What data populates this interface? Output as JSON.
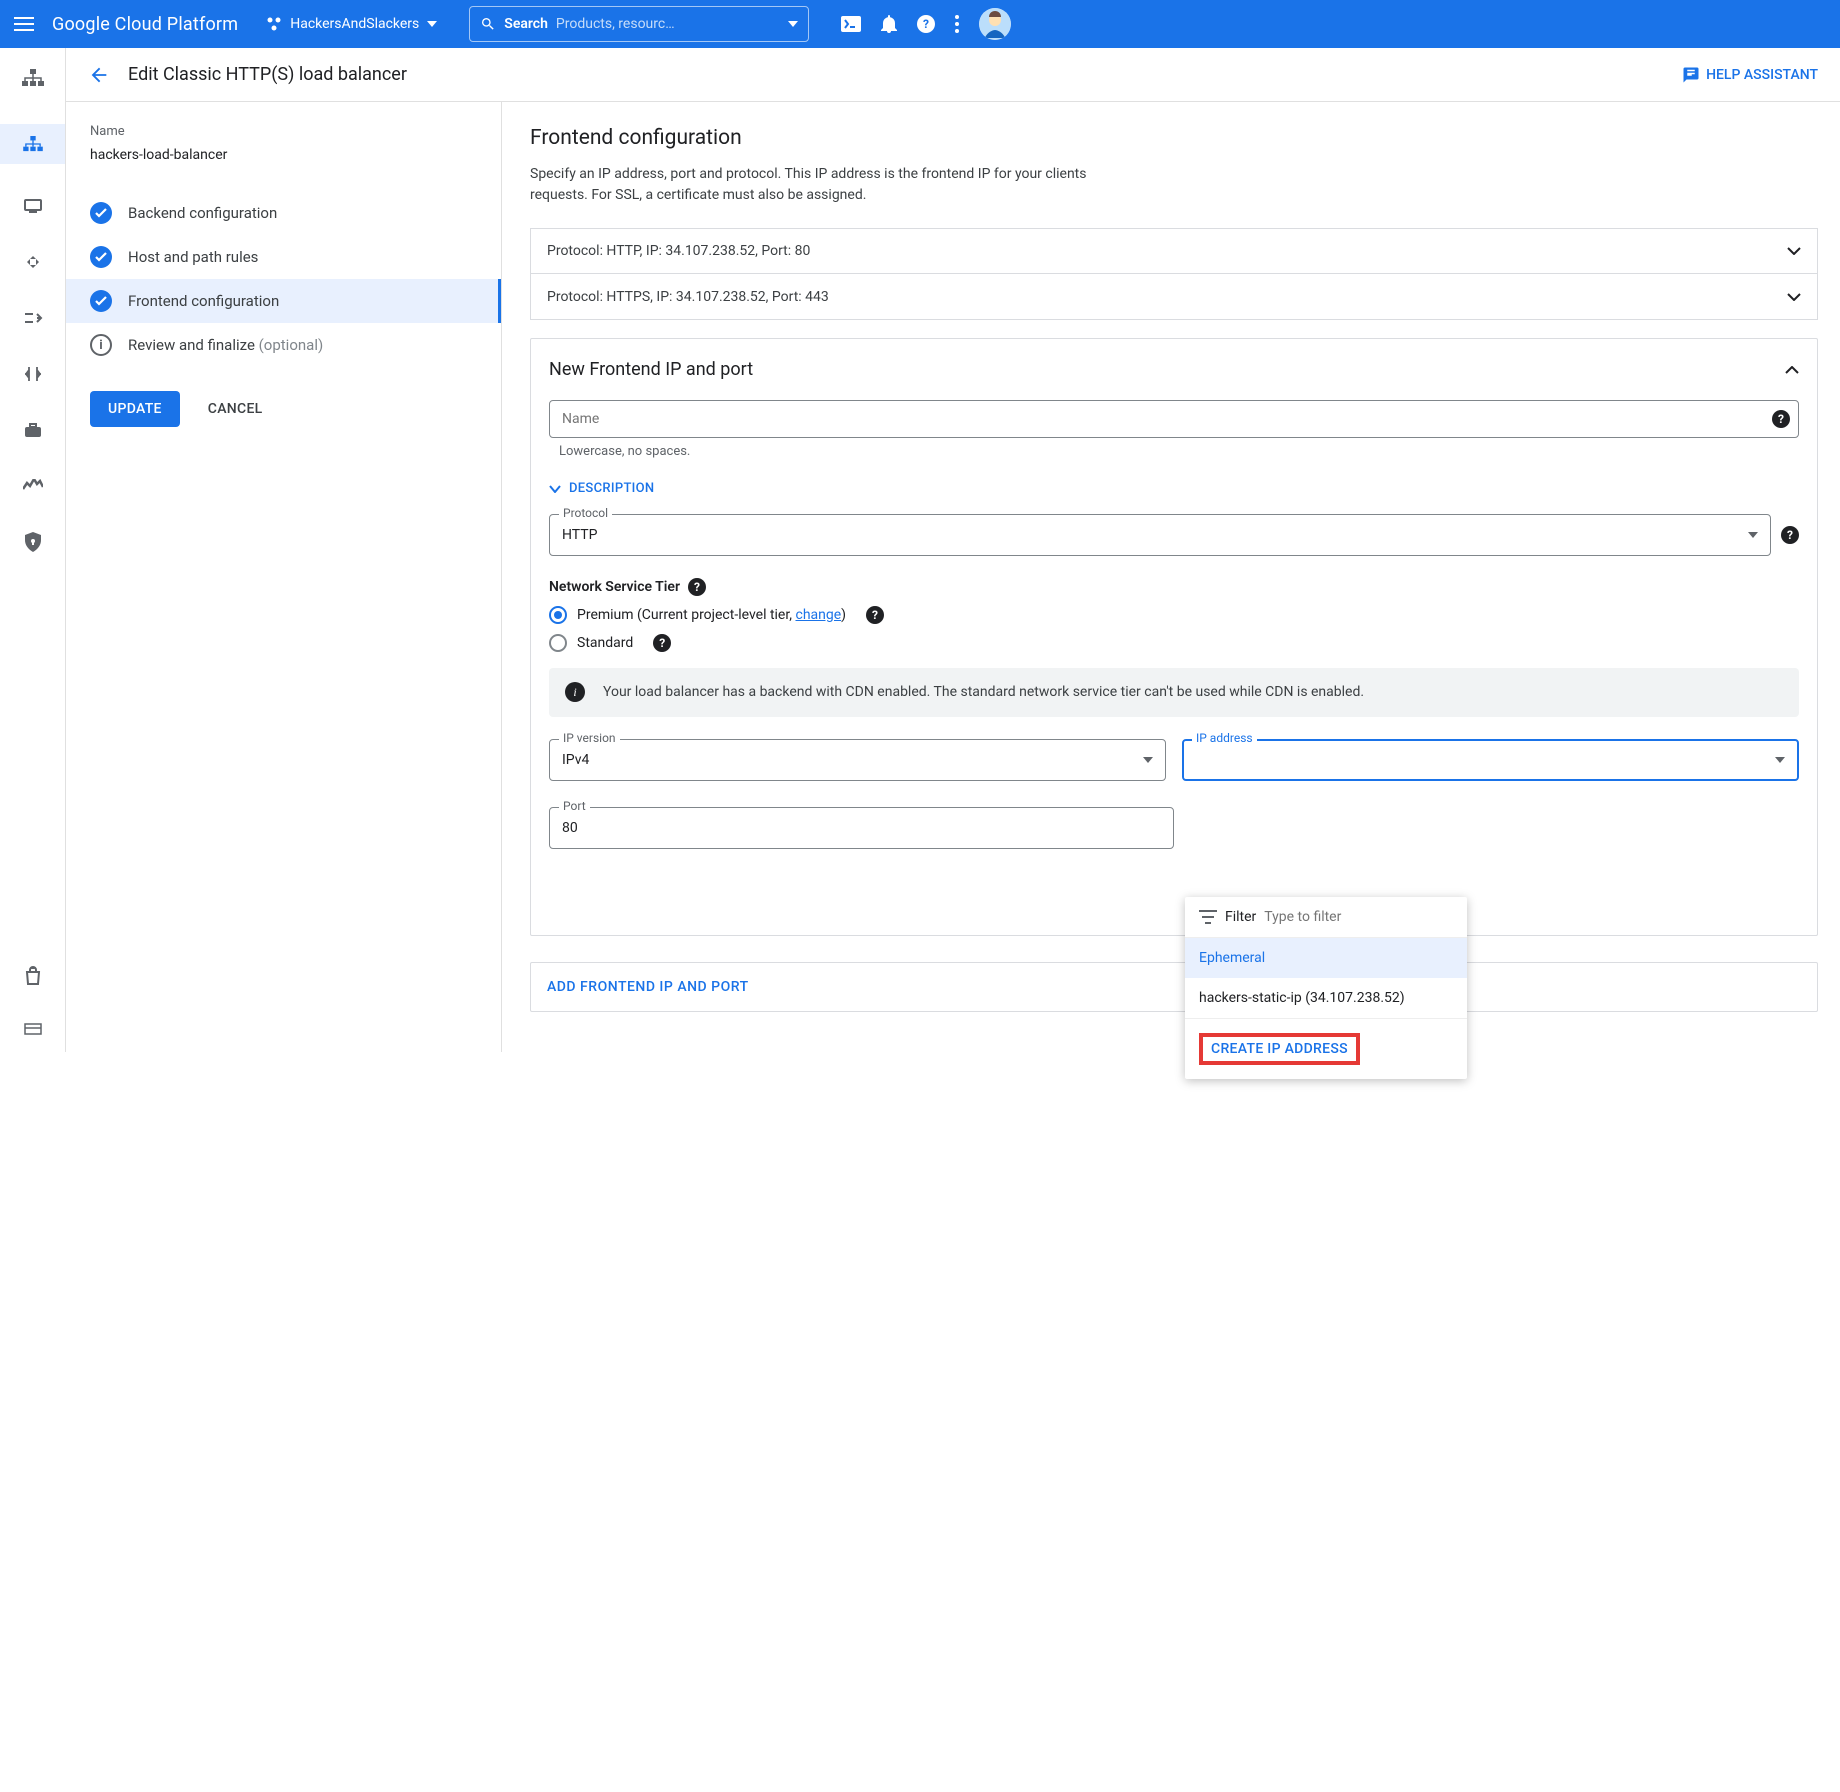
{
  "topbar": {
    "logo": "Google Cloud Platform",
    "project": "HackersAndSlackers",
    "search_label": "Search",
    "search_placeholder": "Products, resourc…"
  },
  "page": {
    "title": "Edit Classic HTTP(S) load balancer",
    "help_assistant": "HELP ASSISTANT"
  },
  "left": {
    "name_label": "Name",
    "name_value": "hackers-load-balancer",
    "steps": {
      "backend": "Backend configuration",
      "hostpath": "Host and path rules",
      "frontend": "Frontend configuration",
      "review": "Review and finalize",
      "review_optional": "(optional)"
    },
    "update": "UPDATE",
    "cancel": "CANCEL"
  },
  "right": {
    "heading": "Frontend configuration",
    "description": "Specify an IP address, port and protocol. This IP address is the frontend IP for your clients requests. For SSL, a certificate must also be assigned.",
    "rows": {
      "http": "Protocol: HTTP, IP: 34.107.238.52, Port: 80",
      "https": "Protocol: HTTPS, IP: 34.107.238.52, Port: 443"
    },
    "panel_title": "New Frontend IP and port",
    "name_placeholder": "Name",
    "name_helper": "Lowercase, no spaces.",
    "description_toggle": "DESCRIPTION",
    "protocol_label": "Protocol",
    "protocol_value": "HTTP",
    "tier_heading": "Network Service Tier",
    "tier_premium_prefix": "Premium (Current project-level tier, ",
    "tier_premium_link": "change",
    "tier_premium_suffix": ")",
    "tier_standard": "Standard",
    "cdn_notice": "Your load balancer has a backend with CDN enabled. The standard network service tier can't be used while CDN is enabled.",
    "ipver_label": "IP version",
    "ipver_value": "IPv4",
    "ipaddr_label": "IP address",
    "port_label": "Port",
    "port_value": "80",
    "add_frontend": "ADD FRONTEND IP AND PORT"
  },
  "dropdown": {
    "filter_label": "Filter",
    "filter_placeholder": "Type to filter",
    "option_ephemeral": "Ephemeral",
    "option_static": "hackers-static-ip (34.107.238.52)",
    "create": "CREATE IP ADDRESS"
  }
}
